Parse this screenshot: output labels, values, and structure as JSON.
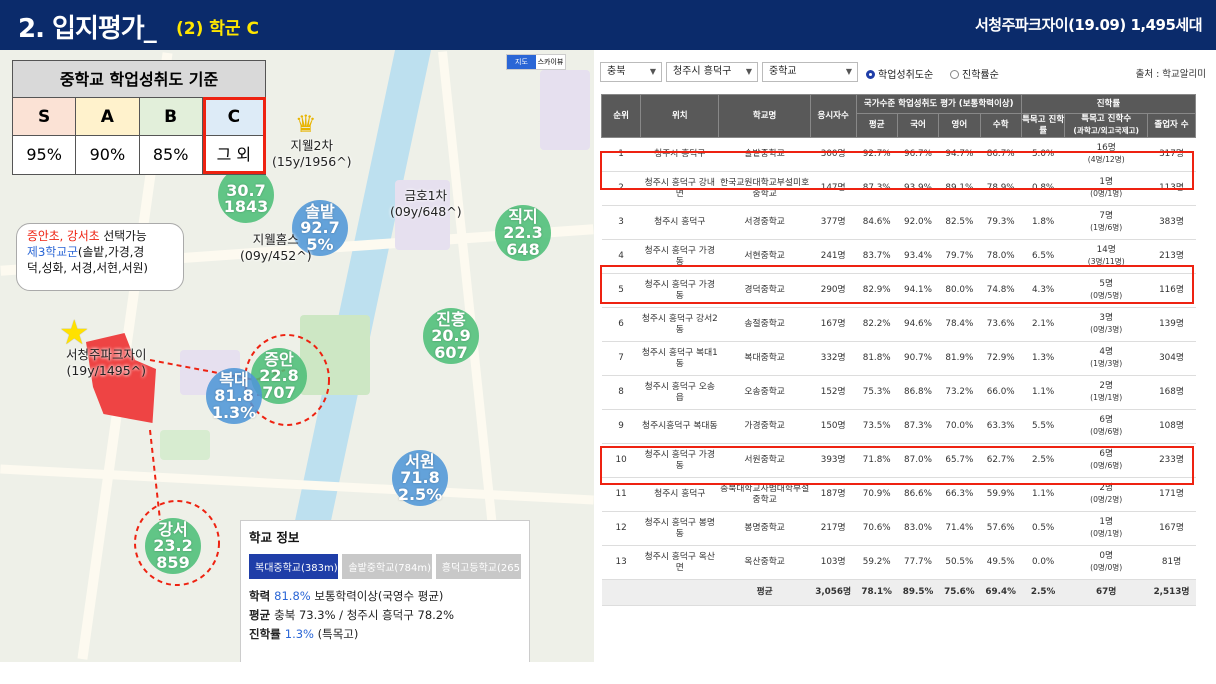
{
  "header": {
    "title": "2. 입지평가_",
    "subtitle": "(2) 학군 C",
    "right": "서청주파크자이(19.09) 1,495세대"
  },
  "criteria": {
    "title": "중학교 학업성취도 기준",
    "grades": [
      "S",
      "A",
      "B",
      "C"
    ],
    "values": [
      "95%",
      "90%",
      "85%",
      "그 외"
    ]
  },
  "bubble": {
    "line1a": "증안초, 강서초",
    "line1b": " 선택가능",
    "line2a": "제3학교군",
    "line2b": "(솔밭,가경,경",
    "line3": "덕,성화, 서경,서현,서원)"
  },
  "map_labels": {
    "apt": "서청주파크자이",
    "apt_sub": "(19y/1495^)",
    "jiwell2": "지웰2차",
    "jiwell2_sub": "(15y/1956^)",
    "kumho": "금호1차",
    "kumho_sub": "(09y/648^)",
    "jiwellhomes": "지웰홈스",
    "jiwellhomes_sub": "(09y/452^)"
  },
  "map_buttons": [
    "지도",
    "스카이뷰"
  ],
  "circles": [
    {
      "name": "",
      "v1": "30.7",
      "v2": "1843"
    },
    {
      "name": "솔밭",
      "v1": "92.7",
      "v2": "5%"
    },
    {
      "name": "직지",
      "v1": "22.3",
      "v2": "648"
    },
    {
      "name": "진흥",
      "v1": "20.9",
      "v2": "607"
    },
    {
      "name": "증안",
      "v1": "22.8",
      "v2": "707"
    },
    {
      "name": "복대",
      "v1": "81.8",
      "v2": "1.3%"
    },
    {
      "name": "서원",
      "v1": "71.8",
      "v2": "2.5%"
    },
    {
      "name": "강서",
      "v1": "23.2",
      "v2": "859"
    }
  ],
  "info": {
    "title": "학교 정보",
    "tabs": [
      "복대중학교(383m)",
      "솔밭중학교(784m)",
      "흥덕고등학교(265"
    ],
    "l1a": "학력 ",
    "l1b": "81.8%",
    "l1c": " 보통학력이상(국영수 평균)",
    "l2a": "평균 ",
    "l2b": "충북 73.3% / 청주시 흥덕구 78.2%",
    "l3a": "진학률 ",
    "l3b": "1.3%",
    "l3c": " (특목고)"
  },
  "filters": {
    "province": "충북",
    "district": "청주시 흥덕구",
    "level": "중학교",
    "radio1": "학업성취도순",
    "radio2": "진학률순",
    "source": "출처 : 학교알리미"
  },
  "table": {
    "headers": {
      "rank": "순위",
      "loc": "위치",
      "school": "학교명",
      "applicants": "응시자수",
      "group1": "국가수준 학업성취도 평가 (보통학력이상)",
      "avg": "평균",
      "kor": "국어",
      "eng": "영어",
      "math": "수학",
      "group2": "진학률",
      "sp": "특목고 진학률",
      "spn": "특목고 진학수",
      "spn_sub": "(과학고/외고국제고)",
      "grad": "졸업자 수"
    },
    "rows": [
      [
        "1",
        "청주시 흥덕구",
        "솔밭중학교",
        "300명",
        "92.7%",
        "96.7%",
        "94.7%",
        "86.7%",
        "5.0%",
        "16명",
        "(4명/12명)",
        "317명"
      ],
      [
        "2",
        "청주시 흥덕구 강내면",
        "한국교원대학교부설미호중학교",
        "147명",
        "87.3%",
        "93.9%",
        "89.1%",
        "78.9%",
        "0.8%",
        "1명",
        "(0명/1명)",
        "113명"
      ],
      [
        "3",
        "청주시 흥덕구",
        "서경중학교",
        "377명",
        "84.6%",
        "92.0%",
        "82.5%",
        "79.3%",
        "1.8%",
        "7명",
        "(1명/6명)",
        "383명"
      ],
      [
        "4",
        "청주시 흥덕구 가경동",
        "서현중학교",
        "241명",
        "83.7%",
        "93.4%",
        "79.7%",
        "78.0%",
        "6.5%",
        "14명",
        "(3명/11명)",
        "213명"
      ],
      [
        "5",
        "청주시 흥덕구 가경동",
        "경덕중학교",
        "290명",
        "82.9%",
        "94.1%",
        "80.0%",
        "74.8%",
        "4.3%",
        "5명",
        "(0명/5명)",
        "116명"
      ],
      [
        "6",
        "청주시 흥덕구 강서2동",
        "송절중학교",
        "167명",
        "82.2%",
        "94.6%",
        "78.4%",
        "73.6%",
        "2.1%",
        "3명",
        "(0명/3명)",
        "139명"
      ],
      [
        "7",
        "청주시 흥덕구 복대1동",
        "복대중학교",
        "332명",
        "81.8%",
        "90.7%",
        "81.9%",
        "72.9%",
        "1.3%",
        "4명",
        "(1명/3명)",
        "304명"
      ],
      [
        "8",
        "청주시 흥덕구 오송읍",
        "오송중학교",
        "152명",
        "75.3%",
        "86.8%",
        "73.2%",
        "66.0%",
        "1.1%",
        "2명",
        "(1명/1명)",
        "168명"
      ],
      [
        "9",
        "청주시흥덕구 복대동",
        "가경중학교",
        "150명",
        "73.5%",
        "87.3%",
        "70.0%",
        "63.3%",
        "5.5%",
        "6명",
        "(0명/6명)",
        "108명"
      ],
      [
        "10",
        "청주시 흥덕구 가경동",
        "서원중학교",
        "393명",
        "71.8%",
        "87.0%",
        "65.7%",
        "62.7%",
        "2.5%",
        "6명",
        "(0명/6명)",
        "233명"
      ],
      [
        "11",
        "청주시 흥덕구",
        "충북대학교사범대학부설중학교",
        "187명",
        "70.9%",
        "86.6%",
        "66.3%",
        "59.9%",
        "1.1%",
        "2명",
        "(0명/2명)",
        "171명"
      ],
      [
        "12",
        "청주시 흥덕구 봉명동",
        "봉명중학교",
        "217명",
        "70.6%",
        "83.0%",
        "71.4%",
        "57.6%",
        "0.5%",
        "1명",
        "(0명/1명)",
        "167명"
      ],
      [
        "13",
        "청주시 흥덕구 옥산면",
        "옥산중학교",
        "103명",
        "59.2%",
        "77.7%",
        "50.5%",
        "49.5%",
        "0.0%",
        "0명",
        "(0명/0명)",
        "81명"
      ]
    ],
    "avg_row": [
      "평균",
      "3,056명",
      "78.1%",
      "89.5%",
      "75.6%",
      "69.4%",
      "2.5%",
      "67명",
      "2,513명"
    ]
  },
  "colors": {
    "navy": "#0b2b6b",
    "yellow": "#ffe600",
    "highlight_red": "#e21",
    "circle_green": "#4dbe78",
    "circle_blue": "#5096d7",
    "grade_s": "#fbe2d5",
    "grade_a": "#fff2cc",
    "grade_b": "#e2efda",
    "grade_c": "#ddebf7"
  }
}
